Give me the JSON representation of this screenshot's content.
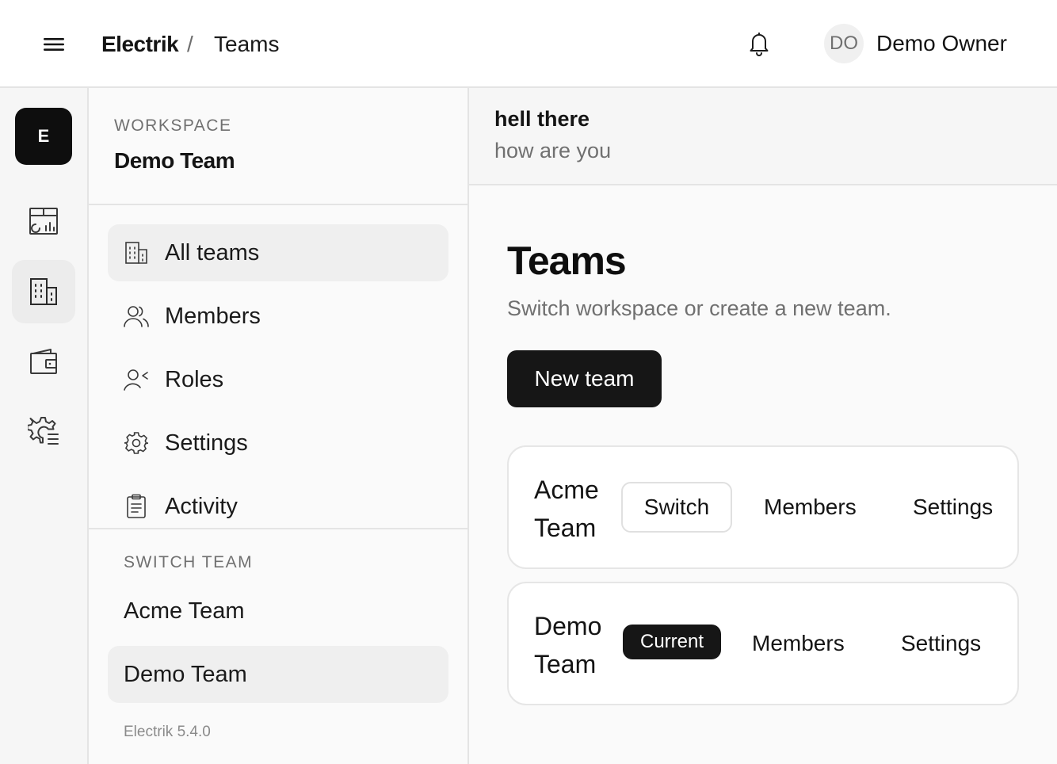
{
  "header": {
    "app_name": "Electrik",
    "separator": "/",
    "current_page": "Teams",
    "menu_icon": "hamburger-icon",
    "notification_icon": "bell-icon",
    "user": {
      "initials": "DO",
      "name": "Demo Owner"
    }
  },
  "rail": {
    "workspace_initial": "E",
    "items": [
      {
        "icon": "dashboard-icon",
        "active": false
      },
      {
        "icon": "building-icon",
        "active": true
      },
      {
        "icon": "wallet-icon",
        "active": false
      },
      {
        "icon": "settings-list-icon",
        "active": false
      }
    ]
  },
  "sidebar": {
    "workspace_label": "WORKSPACE",
    "workspace_name": "Demo Team",
    "nav": [
      {
        "label": "All teams",
        "icon": "building-icon",
        "active": true
      },
      {
        "label": "Members",
        "icon": "users-icon",
        "active": false
      },
      {
        "label": "Roles",
        "icon": "user-role-icon",
        "active": false
      },
      {
        "label": "Settings",
        "icon": "gear-icon",
        "active": false
      },
      {
        "label": "Activity",
        "icon": "clipboard-icon",
        "active": false
      }
    ],
    "switch_label": "SWITCH TEAM",
    "teams": [
      {
        "name": "Acme Team",
        "active": false
      },
      {
        "name": "Demo Team",
        "active": true
      }
    ],
    "version": "Electrik 5.4.0"
  },
  "banner": {
    "title": "hell there",
    "subtitle": "how are you"
  },
  "main": {
    "title": "Teams",
    "subtitle": "Switch workspace or create a new team.",
    "new_team_label": "New team",
    "teams": [
      {
        "name": "Acme Team",
        "action": "Switch",
        "members_label": "Members",
        "settings_label": "Settings",
        "is_current": false
      },
      {
        "name": "Demo Team",
        "action": "Current",
        "members_label": "Members",
        "settings_label": "Settings",
        "is_current": true
      }
    ]
  }
}
